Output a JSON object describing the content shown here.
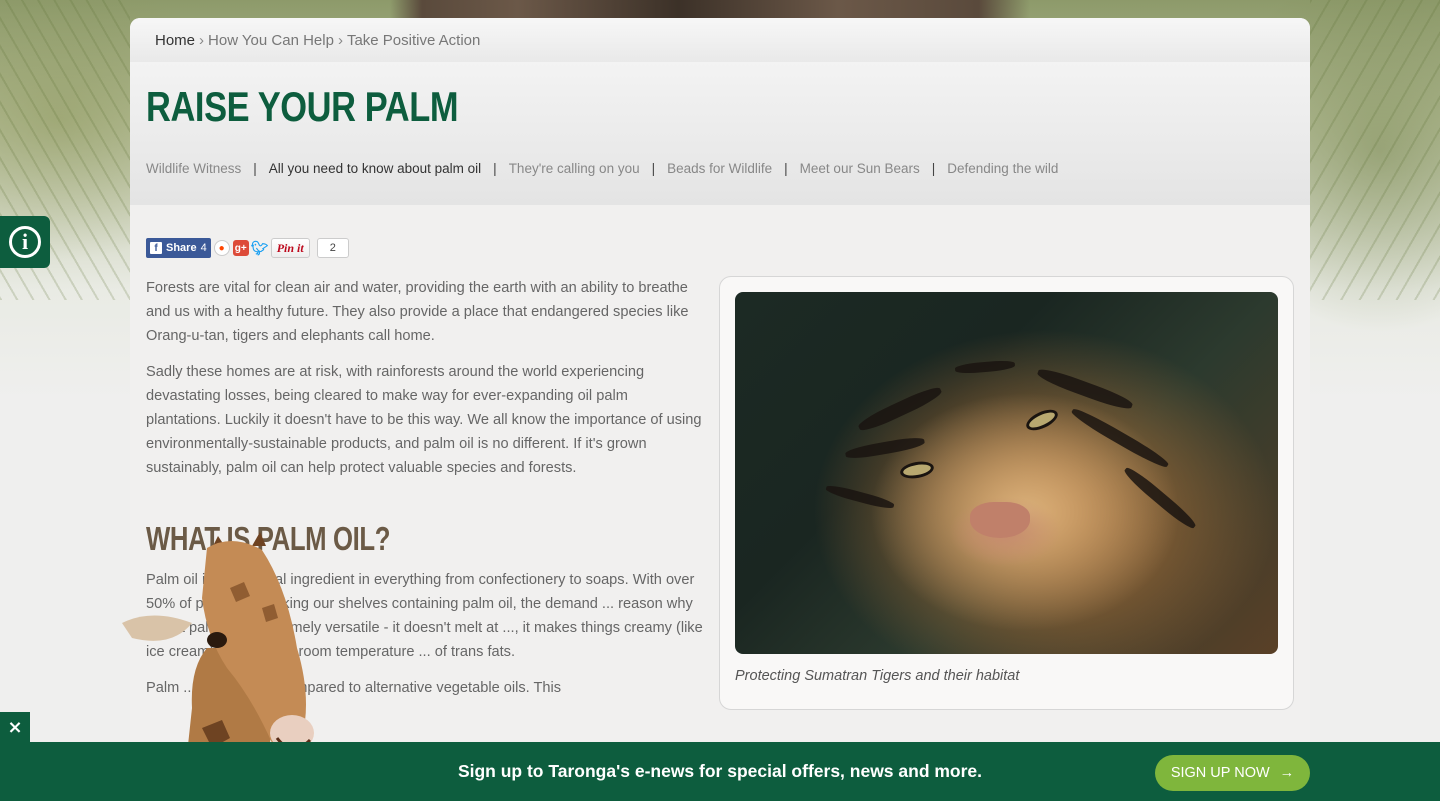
{
  "breadcrumb": {
    "home": "Home",
    "sep": "›",
    "level1": "How You Can Help",
    "level2": "Take Positive Action"
  },
  "page": {
    "title": "RAISE YOUR PALM"
  },
  "subnav": {
    "items": [
      "Wildlife Witness",
      "All you need to know about palm oil",
      "They're calling on you",
      "Beads for Wildlife",
      "Meet our Sun Bears",
      "Defending the wild"
    ],
    "active_index": 1,
    "separator": "|"
  },
  "share": {
    "fb_label": "Share",
    "fb_count": "4",
    "pin_label": "Pin it",
    "pin_count": "2",
    "icons": [
      "facebook-icon",
      "reddit-icon",
      "google-plus-icon",
      "twitter-icon",
      "pinterest-icon"
    ]
  },
  "article": {
    "p1": "Forests are vital for clean air and water, providing the earth with an ability to breathe and us with a healthy future. They also provide a place that endangered species like Orang-u-tan, tigers and elephants call home.",
    "p2": "Sadly these homes are at risk, with rainforests around the world experiencing devastating losses, being cleared to make way for ever-expanding oil palm plantations. Luckily it doesn't have to be this way. We all know the importance of using environmentally-sustainable products, and palm oil is no different. If it's grown sustainably, palm oil can help protect valuable species and forests.",
    "h2": "WHAT IS PALM OIL?",
    "p3": "Palm oil is a essential ingredient in everything from confectionery to soaps. With over 50% of products stocking our shelves containing palm oil, the demand ... reason why is that palm oil is extremely versatile - it doesn't melt at ..., it makes things creamy (like ice cream), it is solid at room temperature ... of trans fats.",
    "p4": "Palm ... ive oil when compared to alternative vegetable oils. This"
  },
  "figure": {
    "caption": "Protecting Sumatran Tigers and their habitat"
  },
  "signup": {
    "text": "Sign up to Taronga's e-news for special offers, news and more.",
    "button": "SIGN UP NOW",
    "arrow": "→",
    "close": "×"
  },
  "colors": {
    "brand_green": "#0d5d3e",
    "button_green": "#7fb63c",
    "heading_brown": "#6b5a46"
  }
}
